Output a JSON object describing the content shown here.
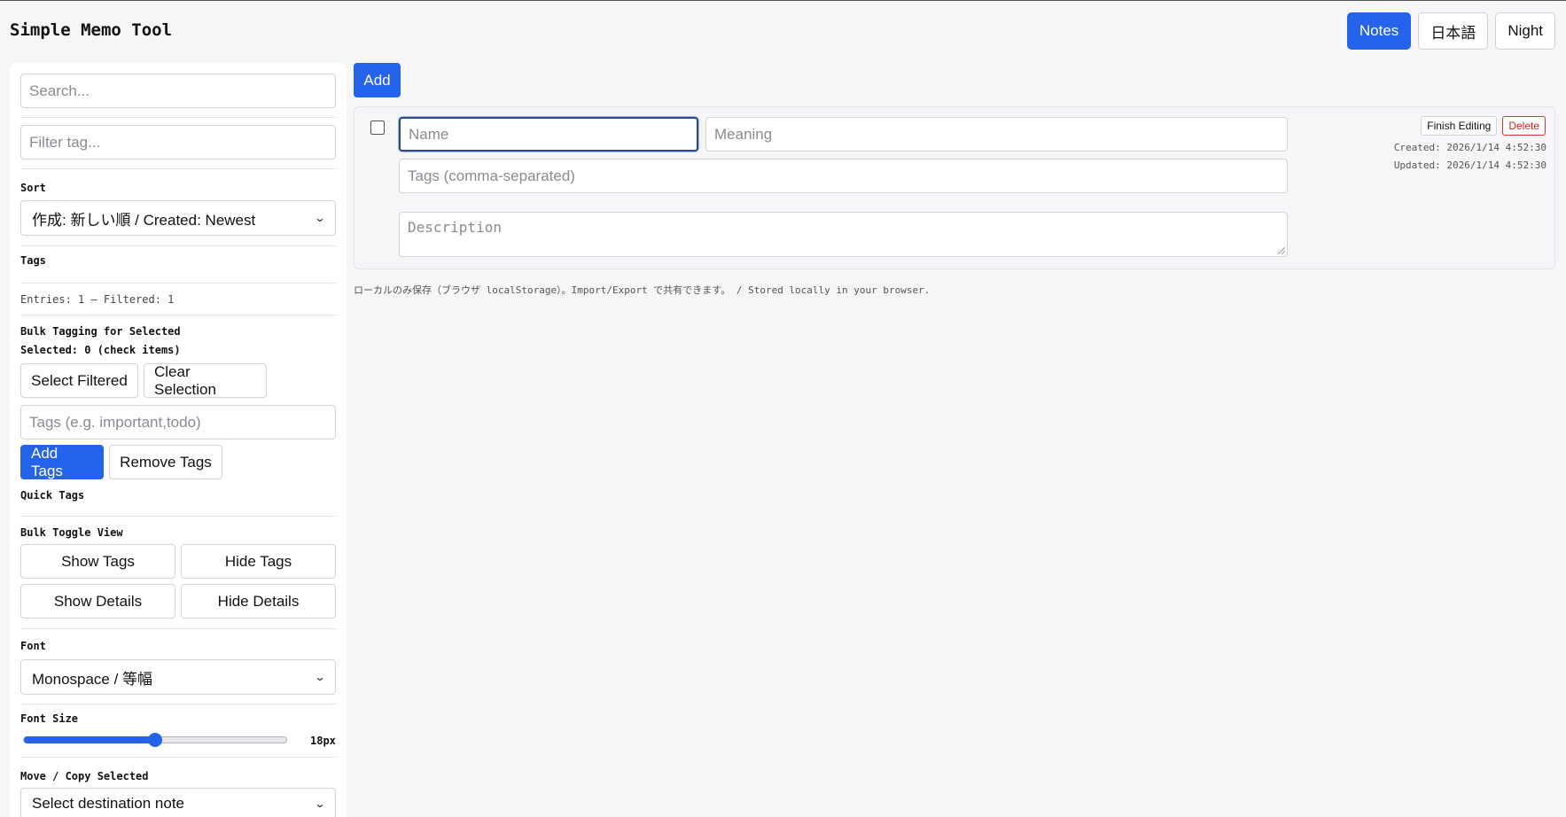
{
  "app": {
    "title": "Simple Memo Tool"
  },
  "header": {
    "notes_label": "Notes",
    "language_label": "日本語",
    "theme_label": "Night"
  },
  "sidebar": {
    "search_placeholder": "Search...",
    "tag_filter_placeholder": "Filter tag...",
    "sort_label": "Sort",
    "sort_selected": "作成: 新しい順 / Created: Newest",
    "tags_label": "Tags",
    "entries_text": "Entries: 1 — Filtered: 1",
    "bulk_tagging_label": "Bulk Tagging for Selected",
    "selected_text": "Selected: 0 (check items)",
    "select_filtered_label": "Select Filtered",
    "clear_selection_label": "Clear Selection",
    "bulk_tags_placeholder": "Tags (e.g. important,todo)",
    "add_tags_label": "Add Tags",
    "remove_tags_label": "Remove Tags",
    "quick_tags_label": "Quick Tags",
    "bulk_toggle_label": "Bulk Toggle View",
    "show_tags_label": "Show Tags",
    "hide_tags_label": "Hide Tags",
    "show_details_label": "Show Details",
    "hide_details_label": "Hide Details",
    "font_label": "Font",
    "font_selected": "Monospace / 等幅",
    "font_size_label": "Font Size",
    "font_size_value": "18px",
    "font_size_fraction": 0.5,
    "move_copy_label": "Move / Copy Selected",
    "destination_selected": "Select destination note"
  },
  "main": {
    "add_label": "Add",
    "entry": {
      "name_placeholder": "Name",
      "meaning_placeholder": "Meaning",
      "tags_placeholder": "Tags (comma-separated)",
      "description_placeholder": "Description",
      "finish_label": "Finish Editing",
      "delete_label": "Delete",
      "created": "Created: 2026/1/14 4:52:30",
      "updated": "Updated: 2026/1/14 4:52:30"
    },
    "footer_note": "ローカルのみ保存（ブラウザ localStorage）。Import/Export で共有できます。 / Stored locally in your browser."
  },
  "colors": {
    "accent": "#2563eb",
    "danger": "#cc2222"
  }
}
